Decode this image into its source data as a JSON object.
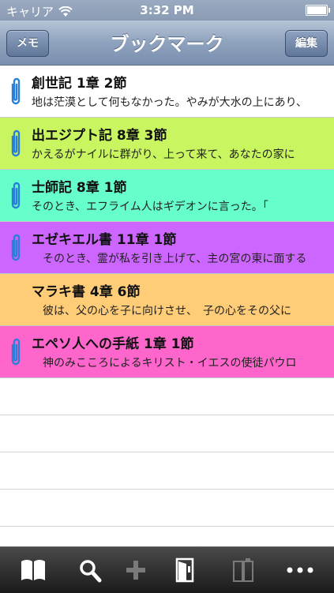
{
  "status": {
    "carrier": "キャリア",
    "time": "3:32 PM"
  },
  "nav": {
    "title": "ブックマーク",
    "left_button": "メモ",
    "right_button": "編集"
  },
  "bookmarks": [
    {
      "title": "創世記 1章 2節",
      "text": "地は茫漠として何もなかった。やみが大水の上にあり、",
      "color": "#ffffff",
      "clip": true
    },
    {
      "title": "出エジプト記 8章 3節",
      "text": "かえるがナイルに群がり、上って来て、あなたの家に",
      "color": "#c8f560",
      "clip": true
    },
    {
      "title": "士師記 8章 1節",
      "text": "そのとき、エフライム人はギデオンに言った。「",
      "color": "#66ffcc",
      "clip": true
    },
    {
      "title": "エゼキエル書 11章 1節",
      "text": "　そのとき、霊が私を引き上げて、主の宮の東に面する",
      "color": "#cc66ff",
      "clip": true
    },
    {
      "title": "マラキ書 4章 6節",
      "text": "　彼は、父の心を子に向けさせ、　子の心をその父に",
      "color": "#ffcc77",
      "clip": false
    },
    {
      "title": "エペソ人への手紙 1章 1節",
      "text": "　神のみこころによるキリスト・イエスの使徒パウロ",
      "color": "#ff66cc",
      "clip": true
    }
  ],
  "colors": {
    "clip": "#2a7fd8",
    "toolbar_icon": "#ffffff",
    "toolbar_icon_disabled": "#7a7a7a"
  },
  "toolbar": [
    {
      "icon": "book-icon",
      "enabled": true
    },
    {
      "icon": "search-icon",
      "enabled": true
    },
    {
      "icon": "plus-icon",
      "enabled": false
    },
    {
      "icon": "bookmark-door-icon",
      "enabled": true
    },
    {
      "icon": "split-view-icon",
      "enabled": false
    },
    {
      "icon": "more-icon",
      "enabled": true
    }
  ]
}
